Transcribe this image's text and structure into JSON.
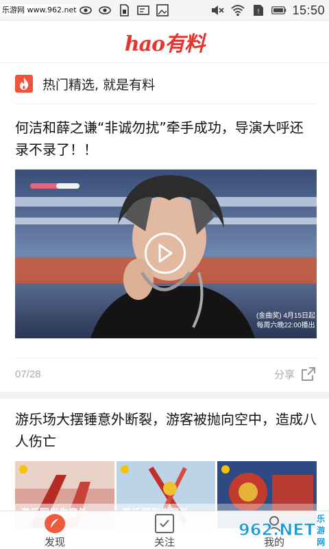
{
  "status_bar": {
    "watermark": "乐游网 www.962.net",
    "time": "15:50"
  },
  "header": {
    "logo": "hao有料"
  },
  "section": {
    "title": "热门精选, 就是有料"
  },
  "article1": {
    "title": "何洁和薛之谦“非诚勿扰”牵手成功，导演大呼还录不录了！！",
    "video_caption_line1": "(金曲奖) 4月15日起",
    "video_caption_line2": "每周六晚22:00播出",
    "date": "07/28",
    "share_label": "分享"
  },
  "article2": {
    "title": "游乐场大摆锤意外断裂，游客被抛向空中，造成八人伤亡",
    "thumb_caption": "游乐园发生意外"
  },
  "bottom_nav": {
    "items": [
      {
        "label": "发现"
      },
      {
        "label": "关注"
      },
      {
        "label": "我的"
      }
    ]
  },
  "site_mark": {
    "logo": "962.NET",
    "sub": "乐游网"
  },
  "colors": {
    "brand_red": "#e8342e",
    "badge_orange": "#f0523a",
    "muted_gray": "#aaaaaa"
  }
}
